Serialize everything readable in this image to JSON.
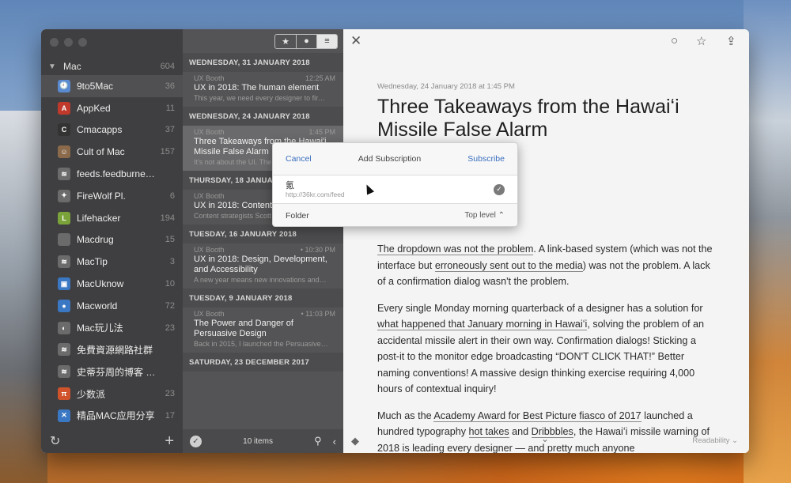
{
  "sidebar": {
    "group": {
      "name": "Mac",
      "count": "604"
    },
    "feeds": [
      {
        "name": "9to5Mac",
        "count": "36",
        "icon": "9to5mac-icon",
        "color": "#5a8ad0",
        "glyph": "🕘"
      },
      {
        "name": "AppKed",
        "count": "11",
        "icon": "appked-icon",
        "color": "#c0392b",
        "glyph": "A"
      },
      {
        "name": "Cmacapps",
        "count": "37",
        "icon": "cmacapps-icon",
        "color": "#333333",
        "glyph": "C"
      },
      {
        "name": "Cult of Mac",
        "count": "157",
        "icon": "cult-of-mac-icon",
        "color": "#8a6a4a",
        "glyph": "☺"
      },
      {
        "name": "feeds.feedburner.com",
        "count": "",
        "icon": "rss-icon",
        "color": "#6b6b6b",
        "glyph": "≋"
      },
      {
        "name": "FireWolf Pl.",
        "count": "6",
        "icon": "firewolf-icon",
        "color": "#6b6b6b",
        "glyph": "✦"
      },
      {
        "name": "Lifehacker",
        "count": "194",
        "icon": "lifehacker-icon",
        "color": "#7aa33a",
        "glyph": "L"
      },
      {
        "name": "Macdrug",
        "count": "15",
        "icon": "macdrug-icon",
        "color": "#6b6b6b",
        "glyph": ""
      },
      {
        "name": "MacTip",
        "count": "3",
        "icon": "rss-icon",
        "color": "#6b6b6b",
        "glyph": "≋"
      },
      {
        "name": "MacUknow",
        "count": "10",
        "icon": "macuknow-icon",
        "color": "#3b78c4",
        "glyph": "▣"
      },
      {
        "name": "Macworld",
        "count": "72",
        "icon": "macworld-icon",
        "color": "#3b78c4",
        "glyph": "●"
      },
      {
        "name": "Mac玩儿法",
        "count": "23",
        "icon": "mac-wanerfa-icon",
        "color": "#6b6b6b",
        "glyph": "◐"
      },
      {
        "name": "免費資源網路社群",
        "count": "",
        "icon": "rss-icon",
        "color": "#6b6b6b",
        "glyph": "≋"
      },
      {
        "name": "史蒂芬周的博客 » Feed…",
        "count": "",
        "icon": "rss-icon",
        "color": "#6b6b6b",
        "glyph": "≋"
      },
      {
        "name": "少数派",
        "count": "23",
        "icon": "sspai-icon",
        "color": "#d0532b",
        "glyph": "π"
      },
      {
        "name": "精品MAC应用分享",
        "count": "17",
        "icon": "xclient-icon",
        "color": "#3b78c4",
        "glyph": "✕"
      }
    ]
  },
  "list": {
    "filters": [
      "★",
      "●",
      "≡"
    ],
    "groups": [
      {
        "day": "WEDNESDAY, 31 JANUARY 2018",
        "items": [
          {
            "source": "UX Booth",
            "time": "12:25 AM",
            "title": "UX in 2018: The human element",
            "excerpt": "This year, we need every designer to fir…",
            "selected": false
          }
        ]
      },
      {
        "day": "WEDNESDAY, 24 JANUARY 2018",
        "items": [
          {
            "source": "UX Booth",
            "time": "1:45 PM",
            "title": "Three Takeaways from the Hawai'i Missile False Alarm",
            "excerpt": "It's not about the UI. The problem…",
            "selected": true
          }
        ]
      },
      {
        "day": "THURSDAY, 18 JANUARY 2018",
        "items": [
          {
            "source": "UX Booth",
            "time": "",
            "title": "UX in 2018: Content",
            "excerpt": "Content strategists Scott Kubie and And…",
            "selected": false
          }
        ]
      },
      {
        "day": "TUESDAY, 16 JANUARY 2018",
        "items": [
          {
            "source": "UX Booth",
            "time": "• 10:30 PM",
            "title": "UX in 2018: Design, Development, and Accessibility",
            "excerpt": "A new year means new innovations and…",
            "selected": false
          }
        ]
      },
      {
        "day": "TUESDAY, 9 JANUARY 2018",
        "items": [
          {
            "source": "UX Booth",
            "time": "• 11:03 PM",
            "title": "The Power and Danger of Persuasive Design",
            "excerpt": "Back in 2015, I launched the Persuasive…",
            "selected": false
          }
        ]
      },
      {
        "day": "SATURDAY, 23 DECEMBER 2017",
        "items": []
      }
    ],
    "count_label": "10 items"
  },
  "reader": {
    "date": "Wednesday, 24 January 2018 at 1:45 PM",
    "title": "Three Takeaways from the Hawaiʻi Missile False Alarm",
    "p1": {
      "a": "The dropdown was not the problem",
      "b": ". A link-based system (which was not the interface but ",
      "c": "erroneously sent out to the media",
      "d": ") was not the problem. A lack of a confirmation dialog wasn't the problem."
    },
    "p2": {
      "a": "Every single Monday morning quarterback of a designer has a solution for ",
      "b": "what happened that January morning in Hawaiʻi",
      "c": ", solving the problem of an accidental missile alert in their own way. Confirmation dialogs! Sticking a post-it to the monitor edge broadcasting “DON'T CLICK THAT!” Better naming conventions! A massive design thinking exercise requiring 4,000 hours of contextual inquiry!"
    },
    "p3": {
      "a": "Much as the ",
      "b": "Academy Award for Best Picture fiasco of 2017",
      "c": " launched a hundred typography ",
      "d": "hot takes",
      "e": " and ",
      "f": "Dribbbles",
      "g": ", the Hawaiʻi missile warning of 2018 is leading every designer — and pretty much anyone"
    },
    "readability": "Readability"
  },
  "dialog": {
    "cancel": "Cancel",
    "title": "Add Subscription",
    "subscribe": "Subscribe",
    "feed_name": "氪",
    "feed_url": "http://36kr.com/feed",
    "folder_label": "Folder",
    "folder_value": "Top level ⌃"
  },
  "colors": {
    "accent": "#3a6fbf"
  }
}
